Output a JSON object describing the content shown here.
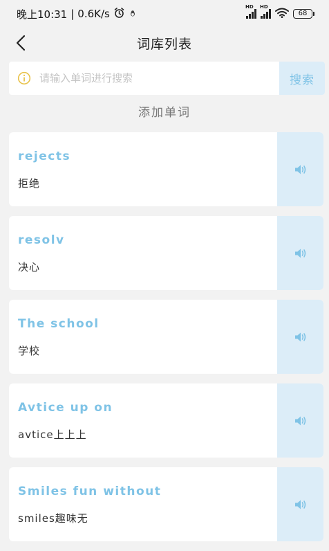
{
  "status_bar": {
    "time": "晚上10:31",
    "network_speed": "0.6K/s",
    "separator": "|",
    "signal_1_label": "HD",
    "signal_2_label": "HD",
    "battery": "68"
  },
  "nav": {
    "title": "词库列表",
    "back_icon": "chevron-left-icon"
  },
  "search": {
    "placeholder": "请输入单词进行搜索",
    "value": "",
    "button_label": "搜索",
    "icon": "info-icon"
  },
  "add_word_label": "添加单词",
  "words": [
    {
      "en": "rejects",
      "zh": "拒绝"
    },
    {
      "en": "resolv",
      "zh": "决心"
    },
    {
      "en": "The school",
      "zh": "学校"
    },
    {
      "en": "Avtice up on",
      "zh": "avtice上上上"
    },
    {
      "en": "Smiles fun without",
      "zh": "smiles趣味无"
    }
  ],
  "colors": {
    "accent": "#7fc3e6",
    "accent_bg": "#dcedf8",
    "info_icon": "#e8c24a",
    "background": "#f2f2f2"
  }
}
